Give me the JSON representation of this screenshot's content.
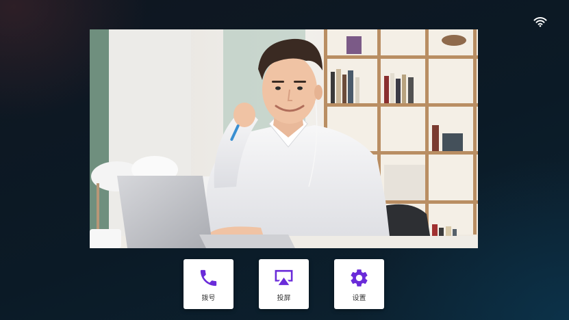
{
  "status_bar": {
    "wifi_icon": "wifi-icon"
  },
  "video_feed": {
    "content": "person-at-laptop-video"
  },
  "dock": {
    "accent_color": "#6a2bd9",
    "items": [
      {
        "label": "拨号",
        "icon": "phone-icon"
      },
      {
        "label": "投屏",
        "icon": "screen-cast-icon"
      },
      {
        "label": "设置",
        "icon": "gear-icon"
      }
    ]
  }
}
